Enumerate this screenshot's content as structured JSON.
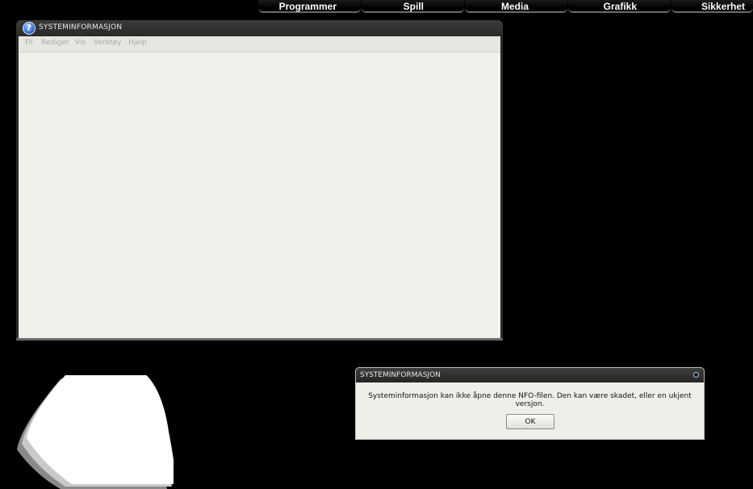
{
  "top_nav": {
    "tabs": [
      {
        "label": "Programmer"
      },
      {
        "label": "Spill"
      },
      {
        "label": "Media"
      },
      {
        "label": "Grafikk"
      },
      {
        "label": "Sikkerhet"
      }
    ]
  },
  "main_window": {
    "title": "SYSTEMINFORMASJON",
    "icon": "help-icon",
    "menu": [
      "Fil",
      "Rediger",
      "Vis",
      "Verktøy",
      "Hjelp"
    ]
  },
  "dialog": {
    "title": "SYSTEMINFORMASJON",
    "message": "Systeminformasjon kan ikke åpne denne NFO-filen. Den kan være skadet, eller en ukjent versjon.",
    "ok_label": "OK"
  },
  "colors": {
    "desktop": "#000000",
    "window_body": "#f1f1ec",
    "menubar": "#e7e6e0",
    "titlebar": "#2b2b2b"
  }
}
